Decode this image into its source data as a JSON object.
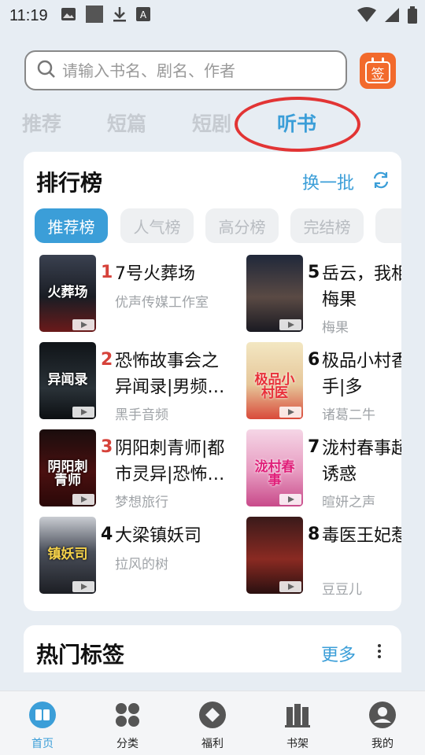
{
  "status_bar": {
    "time": "11:19"
  },
  "search": {
    "placeholder": "请输入书名、剧名、作者"
  },
  "signin": {
    "label": "签"
  },
  "tabs": [
    {
      "label": "推荐",
      "active": false
    },
    {
      "label": "短篇",
      "active": false
    },
    {
      "label": "短剧",
      "active": false
    },
    {
      "label": "听书",
      "active": true
    }
  ],
  "ranking": {
    "title": "排行榜",
    "refresh_label": "换一批",
    "pills": [
      {
        "label": "推荐榜",
        "active": true
      },
      {
        "label": "人气榜",
        "active": false
      },
      {
        "label": "高分榜",
        "active": false
      },
      {
        "label": "完结榜",
        "active": false
      }
    ],
    "books": [
      {
        "rank": "1",
        "title": "7号火葬场",
        "author": "优声传媒工作室",
        "cover_text": "火葬场"
      },
      {
        "rank": "2",
        "title": "恐怖故事会之异闻录|男频…",
        "author": "黑手音频",
        "cover_text": "异闻录"
      },
      {
        "rank": "3",
        "title": "阴阳刺青师|都市灵异|恐怖…",
        "author": "梦想旅行",
        "cover_text": "阴阳刺青师"
      },
      {
        "rank": "4",
        "title": "大梁镇妖司",
        "author": "拉风的树",
        "cover_text": "镇妖司"
      },
      {
        "rank": "5",
        "title": "岳云，我相爷|梅果",
        "author": "梅果",
        "cover_text": ""
      },
      {
        "rank": "6",
        "title": "极品小村香高手|多",
        "author": "诸葛二牛",
        "cover_text": "极品小村医"
      },
      {
        "rank": "7",
        "title": "泷村春事超级诱惑",
        "author": "暄妍之声",
        "cover_text": "泷村春事"
      },
      {
        "rank": "8",
        "title": "毒医王妃惹",
        "author": "豆豆儿",
        "cover_text": ""
      }
    ]
  },
  "hot_tags": {
    "title": "热门标签",
    "more_label": "更多"
  },
  "bottom_nav": [
    {
      "label": "首页",
      "icon": "book-open-icon",
      "active": true
    },
    {
      "label": "分类",
      "icon": "grid-icon",
      "active": false
    },
    {
      "label": "福利",
      "icon": "gift-icon",
      "active": false
    },
    {
      "label": "书架",
      "icon": "bookshelf-icon",
      "active": false
    },
    {
      "label": "我的",
      "icon": "profile-icon",
      "active": false
    }
  ],
  "colors": {
    "accent": "#3b9ed8",
    "rank_red": "#d6423a",
    "signin": "#f26a2c",
    "annotation": "#e23434"
  }
}
